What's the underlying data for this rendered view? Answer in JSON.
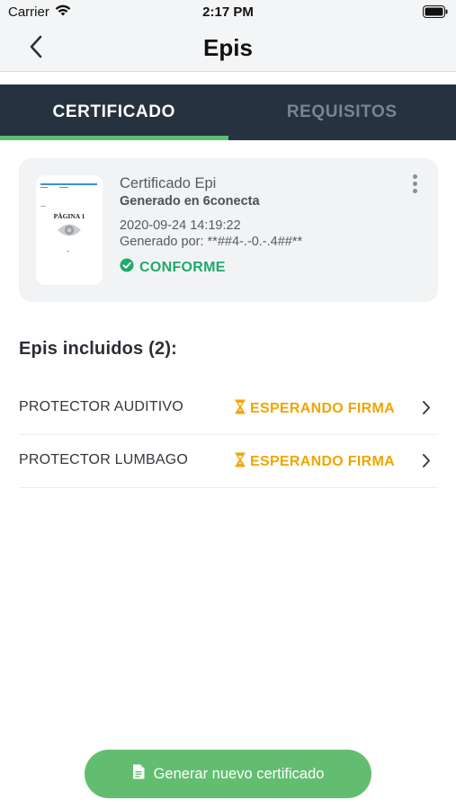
{
  "status_bar": {
    "carrier": "Carrier",
    "time": "2:17 PM"
  },
  "nav": {
    "title": "Epis",
    "back_icon": "chevron-left-icon"
  },
  "tabs": [
    {
      "label": "CERTIFICADO",
      "active": true
    },
    {
      "label": "REQUISITOS",
      "active": false
    }
  ],
  "certificate": {
    "thumbnail_page_label": "PÁGINA 1",
    "title": "Certificado Epi",
    "subtitle": "Generado en 6conecta",
    "date": "2020-09-24 14:19:22",
    "generated_by": "Generado por: **##4-.-0.-.4##**",
    "status": "CONFORME",
    "status_color": "#1eaa6e"
  },
  "epis_section": {
    "title": "Epis incluidos (2):",
    "items": [
      {
        "name": "PROTECTOR AUDITIVO",
        "status": "ESPERANDO FIRMA"
      },
      {
        "name": "PROTECTOR LUMBAGO",
        "status": "ESPERANDO FIRMA"
      }
    ],
    "status_color": "#f0a500"
  },
  "actions": {
    "generate_label": "Generar nuevo certificado",
    "accent": "#62bd70"
  }
}
